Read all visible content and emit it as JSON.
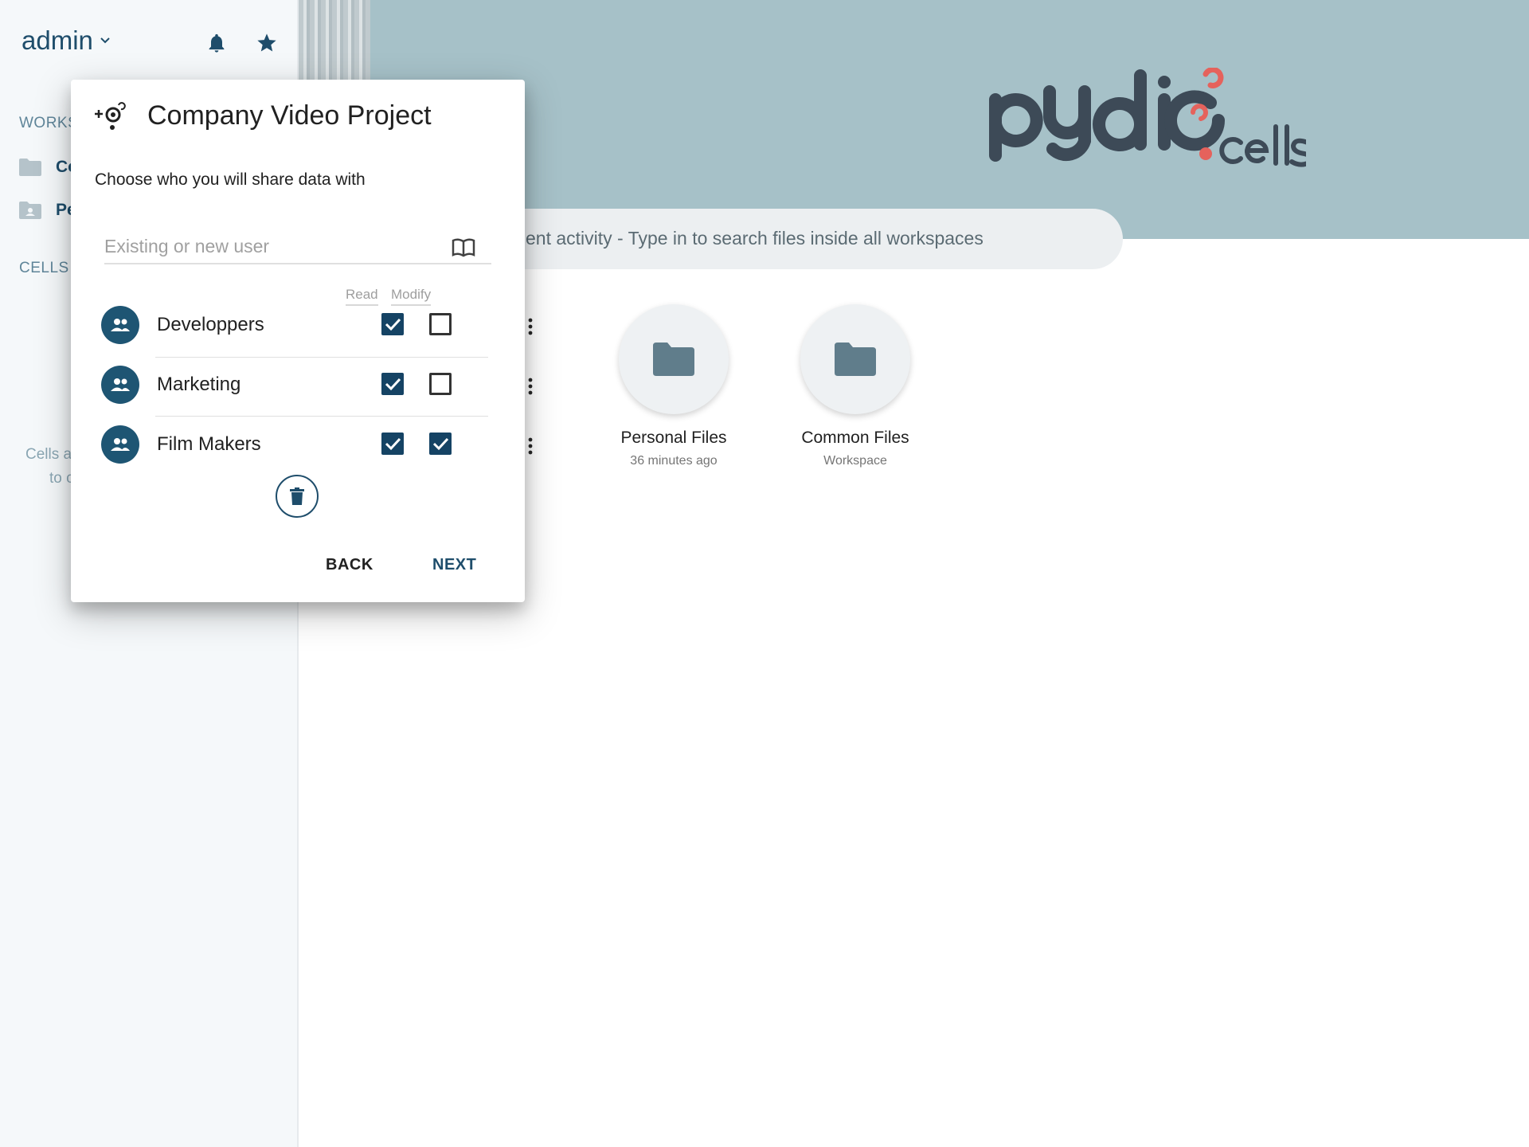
{
  "sidebar": {
    "user": "admin",
    "section_workspaces": "WORKS",
    "section_cells": "CELLS",
    "items": [
      {
        "label": "Co"
      },
      {
        "label": "Pe"
      }
    ],
    "note_line1": "Cells a",
    "note_line2": "to c"
  },
  "header": {
    "search_text": "ent activity - Type in to search files inside all workspaces"
  },
  "workspaces": [
    {
      "title": "Personal Files",
      "subtitle": "36 minutes ago"
    },
    {
      "title": "Common Files",
      "subtitle": "Workspace"
    }
  ],
  "dialog": {
    "title": "Company Video Project",
    "subtitle": "Choose who you will share data with",
    "input_placeholder": "Existing or new user",
    "col_read": "Read",
    "col_modify": "Modify",
    "rows": [
      {
        "label": "Developpers",
        "read": true,
        "modify": false
      },
      {
        "label": "Marketing",
        "read": true,
        "modify": false
      },
      {
        "label": "Film Makers",
        "read": true,
        "modify": true
      }
    ],
    "back_label": "BACK",
    "next_label": "NEXT"
  },
  "colors": {
    "primary": "#1e4d6b",
    "checkbox": "#154364",
    "hero": "#a6c1c8",
    "logo_dark": "#3d4a57",
    "logo_accent": "#e5625c"
  }
}
